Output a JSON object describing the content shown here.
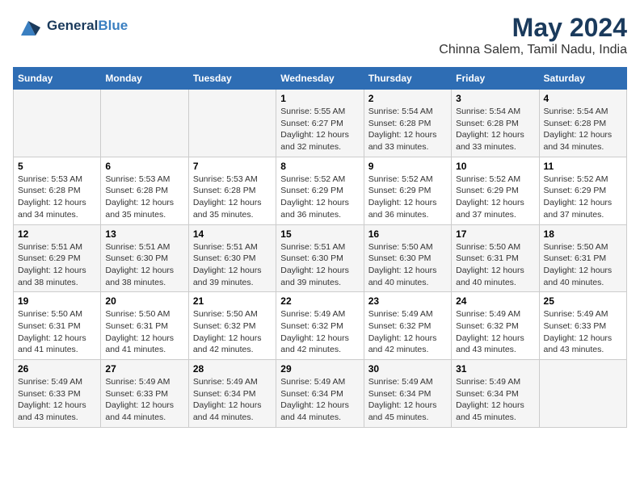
{
  "header": {
    "logo_general": "General",
    "logo_blue": "Blue",
    "title": "May 2024",
    "subtitle": "Chinna Salem, Tamil Nadu, India"
  },
  "weekdays": [
    "Sunday",
    "Monday",
    "Tuesday",
    "Wednesday",
    "Thursday",
    "Friday",
    "Saturday"
  ],
  "weeks": [
    [
      {
        "day": "",
        "detail": ""
      },
      {
        "day": "",
        "detail": ""
      },
      {
        "day": "",
        "detail": ""
      },
      {
        "day": "1",
        "detail": "Sunrise: 5:55 AM\nSunset: 6:27 PM\nDaylight: 12 hours\nand 32 minutes."
      },
      {
        "day": "2",
        "detail": "Sunrise: 5:54 AM\nSunset: 6:28 PM\nDaylight: 12 hours\nand 33 minutes."
      },
      {
        "day": "3",
        "detail": "Sunrise: 5:54 AM\nSunset: 6:28 PM\nDaylight: 12 hours\nand 33 minutes."
      },
      {
        "day": "4",
        "detail": "Sunrise: 5:54 AM\nSunset: 6:28 PM\nDaylight: 12 hours\nand 34 minutes."
      }
    ],
    [
      {
        "day": "5",
        "detail": "Sunrise: 5:53 AM\nSunset: 6:28 PM\nDaylight: 12 hours\nand 34 minutes."
      },
      {
        "day": "6",
        "detail": "Sunrise: 5:53 AM\nSunset: 6:28 PM\nDaylight: 12 hours\nand 35 minutes."
      },
      {
        "day": "7",
        "detail": "Sunrise: 5:53 AM\nSunset: 6:28 PM\nDaylight: 12 hours\nand 35 minutes."
      },
      {
        "day": "8",
        "detail": "Sunrise: 5:52 AM\nSunset: 6:29 PM\nDaylight: 12 hours\nand 36 minutes."
      },
      {
        "day": "9",
        "detail": "Sunrise: 5:52 AM\nSunset: 6:29 PM\nDaylight: 12 hours\nand 36 minutes."
      },
      {
        "day": "10",
        "detail": "Sunrise: 5:52 AM\nSunset: 6:29 PM\nDaylight: 12 hours\nand 37 minutes."
      },
      {
        "day": "11",
        "detail": "Sunrise: 5:52 AM\nSunset: 6:29 PM\nDaylight: 12 hours\nand 37 minutes."
      }
    ],
    [
      {
        "day": "12",
        "detail": "Sunrise: 5:51 AM\nSunset: 6:29 PM\nDaylight: 12 hours\nand 38 minutes."
      },
      {
        "day": "13",
        "detail": "Sunrise: 5:51 AM\nSunset: 6:30 PM\nDaylight: 12 hours\nand 38 minutes."
      },
      {
        "day": "14",
        "detail": "Sunrise: 5:51 AM\nSunset: 6:30 PM\nDaylight: 12 hours\nand 39 minutes."
      },
      {
        "day": "15",
        "detail": "Sunrise: 5:51 AM\nSunset: 6:30 PM\nDaylight: 12 hours\nand 39 minutes."
      },
      {
        "day": "16",
        "detail": "Sunrise: 5:50 AM\nSunset: 6:30 PM\nDaylight: 12 hours\nand 40 minutes."
      },
      {
        "day": "17",
        "detail": "Sunrise: 5:50 AM\nSunset: 6:31 PM\nDaylight: 12 hours\nand 40 minutes."
      },
      {
        "day": "18",
        "detail": "Sunrise: 5:50 AM\nSunset: 6:31 PM\nDaylight: 12 hours\nand 40 minutes."
      }
    ],
    [
      {
        "day": "19",
        "detail": "Sunrise: 5:50 AM\nSunset: 6:31 PM\nDaylight: 12 hours\nand 41 minutes."
      },
      {
        "day": "20",
        "detail": "Sunrise: 5:50 AM\nSunset: 6:31 PM\nDaylight: 12 hours\nand 41 minutes."
      },
      {
        "day": "21",
        "detail": "Sunrise: 5:50 AM\nSunset: 6:32 PM\nDaylight: 12 hours\nand 42 minutes."
      },
      {
        "day": "22",
        "detail": "Sunrise: 5:49 AM\nSunset: 6:32 PM\nDaylight: 12 hours\nand 42 minutes."
      },
      {
        "day": "23",
        "detail": "Sunrise: 5:49 AM\nSunset: 6:32 PM\nDaylight: 12 hours\nand 42 minutes."
      },
      {
        "day": "24",
        "detail": "Sunrise: 5:49 AM\nSunset: 6:32 PM\nDaylight: 12 hours\nand 43 minutes."
      },
      {
        "day": "25",
        "detail": "Sunrise: 5:49 AM\nSunset: 6:33 PM\nDaylight: 12 hours\nand 43 minutes."
      }
    ],
    [
      {
        "day": "26",
        "detail": "Sunrise: 5:49 AM\nSunset: 6:33 PM\nDaylight: 12 hours\nand 43 minutes."
      },
      {
        "day": "27",
        "detail": "Sunrise: 5:49 AM\nSunset: 6:33 PM\nDaylight: 12 hours\nand 44 minutes."
      },
      {
        "day": "28",
        "detail": "Sunrise: 5:49 AM\nSunset: 6:34 PM\nDaylight: 12 hours\nand 44 minutes."
      },
      {
        "day": "29",
        "detail": "Sunrise: 5:49 AM\nSunset: 6:34 PM\nDaylight: 12 hours\nand 44 minutes."
      },
      {
        "day": "30",
        "detail": "Sunrise: 5:49 AM\nSunset: 6:34 PM\nDaylight: 12 hours\nand 45 minutes."
      },
      {
        "day": "31",
        "detail": "Sunrise: 5:49 AM\nSunset: 6:34 PM\nDaylight: 12 hours\nand 45 minutes."
      },
      {
        "day": "",
        "detail": ""
      }
    ]
  ]
}
